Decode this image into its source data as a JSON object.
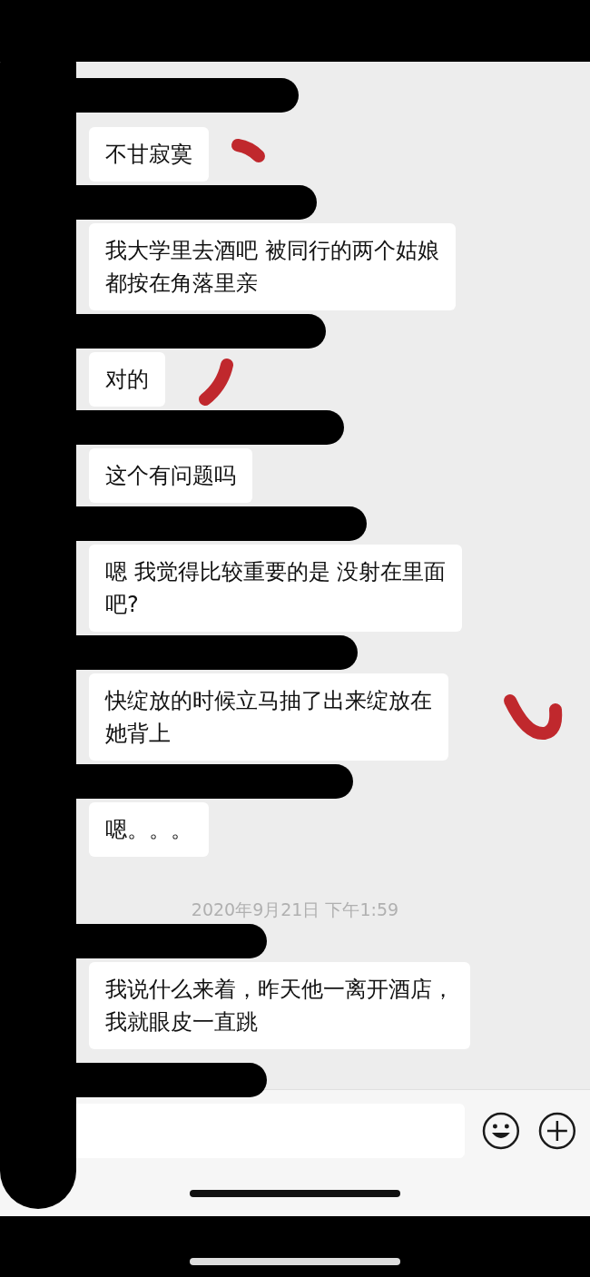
{
  "messages": [
    {
      "kind": "bubble",
      "text": "不甘寂寞"
    },
    {
      "kind": "bubble",
      "lines": [
        "我大学里去酒吧 被同行的两个姑娘",
        "都按在角落里亲"
      ]
    },
    {
      "kind": "bubble",
      "text": "对的"
    },
    {
      "kind": "bubble",
      "text": "这个有问题吗"
    },
    {
      "kind": "bubble",
      "lines": [
        "嗯 我觉得比较重要的是 没射在里面",
        "吧?"
      ]
    },
    {
      "kind": "bubble",
      "lines": [
        "快绽放的时候立马抽了出来绽放在",
        "她背上"
      ]
    },
    {
      "kind": "bubble",
      "text": "嗯。。。"
    },
    {
      "kind": "timestamp",
      "text": "2020年9月21日 下午1:59"
    },
    {
      "kind": "bubble",
      "lines": [
        "我说什么来着，昨天他一离开酒店，",
        "我就眼皮一直跳"
      ]
    }
  ]
}
